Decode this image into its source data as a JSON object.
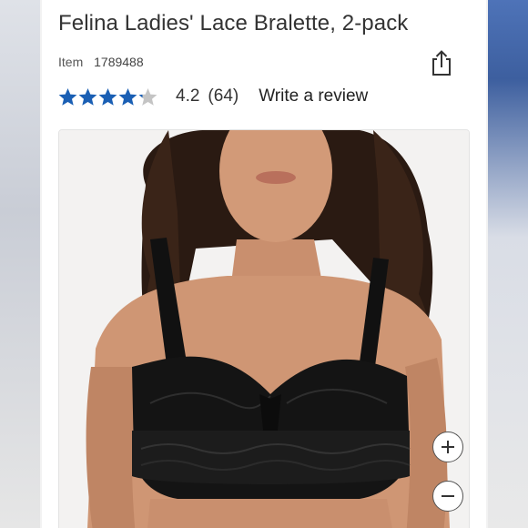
{
  "product": {
    "title": "Felina Ladies' Lace Bralette, 2-pack",
    "item_label": "Item",
    "item_number": "1789488"
  },
  "rating": {
    "stars_filled": 4.2,
    "stars_total": 5,
    "value": "4.2",
    "count": "(64)",
    "write_review_label": "Write a review"
  },
  "icons": {
    "share": "share-icon",
    "star": "star-icon",
    "zoom_in": "plus-icon",
    "zoom_out": "minus-icon"
  },
  "colors": {
    "star_filled": "#1a5fb4",
    "star_empty": "#c4c4c4",
    "text": "#333333"
  }
}
